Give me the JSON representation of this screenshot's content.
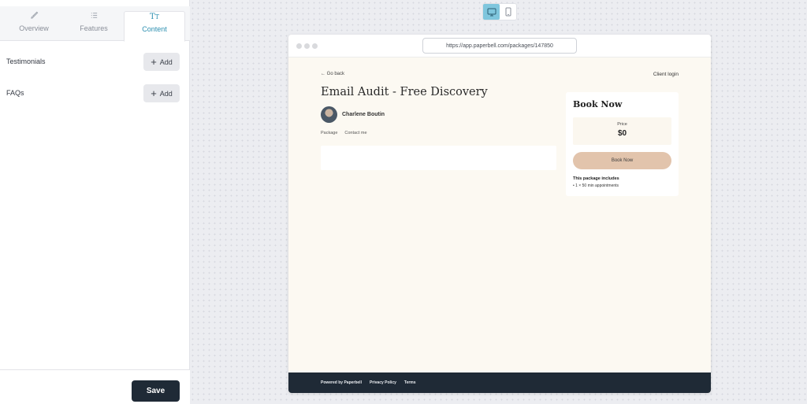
{
  "editor": {
    "tabs": [
      {
        "label": "Overview",
        "icon": "brush-icon"
      },
      {
        "label": "Features",
        "icon": "list-icon"
      },
      {
        "label": "Content",
        "icon": "typography-icon",
        "active": true
      }
    ],
    "sections": [
      {
        "label": "Testimonials",
        "add_label": "Add"
      },
      {
        "label": "FAQs",
        "add_label": "Add"
      }
    ],
    "save_label": "Save"
  },
  "preview": {
    "device_modes": [
      "desktop",
      "mobile"
    ],
    "active_device": "desktop",
    "url": "https://app.paperbell.com/packages/147850",
    "go_back": "← Go back",
    "client_login": "Client login",
    "title": "Email Audit - Free Discovery",
    "author": "Charlene Boutin",
    "tabs": [
      "Package",
      "Contact me"
    ],
    "book": {
      "title": "Book Now",
      "price_label": "Price",
      "price_value": "$0",
      "button_label": "Book Now",
      "includes_title": "This package includes",
      "includes_items": [
        "• 1 × 50 min appointments"
      ]
    },
    "footer": {
      "powered_by": "Powered by Paperbell",
      "privacy": "Privacy Policy",
      "terms": "Terms"
    }
  },
  "colors": {
    "accent": "#2c8fb0",
    "save_button": "#1f2a36",
    "book_button": "#e2c4ac",
    "page_background": "#fcf9f2"
  }
}
